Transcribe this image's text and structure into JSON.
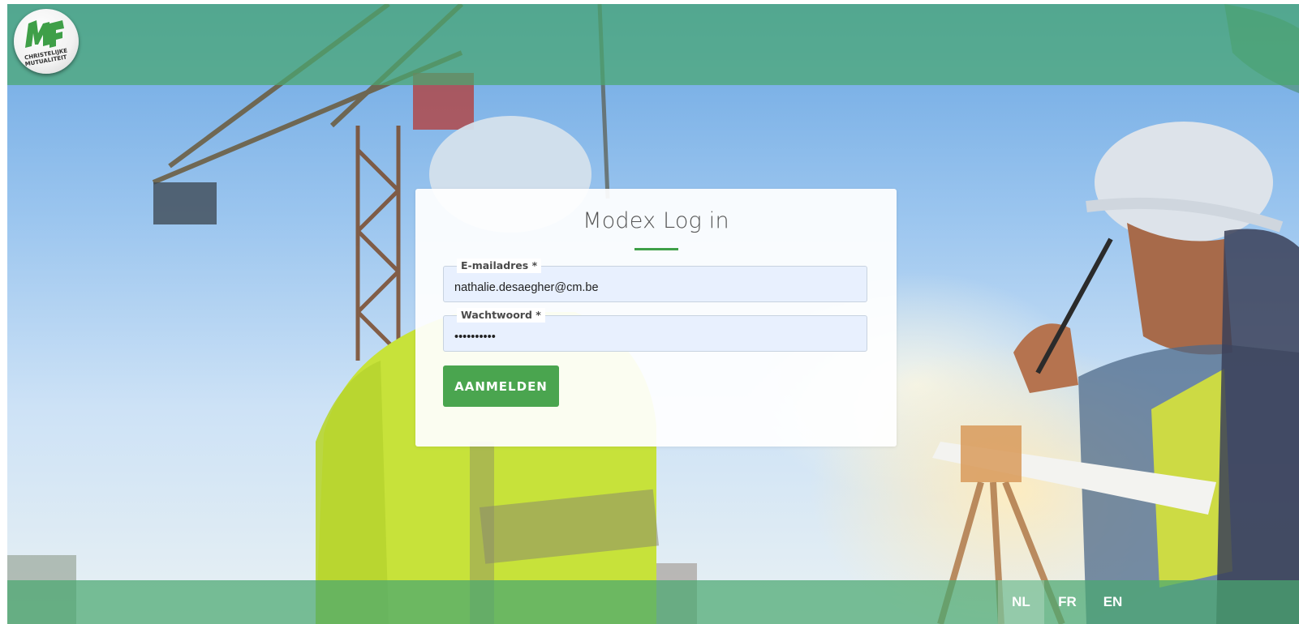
{
  "brand": {
    "logo_text_line1": "CHRISTELIJKE",
    "logo_text_line2": "MUTUALITEIT",
    "accent_color": "#4aa54f",
    "bar_color": "#4aa770"
  },
  "login": {
    "title": "Modex Log in",
    "email_label": "E-mailadres *",
    "email_value": "nathalie.desaegher@cm.be",
    "password_label": "Wachtwoord *",
    "password_value": "••••••••••",
    "submit_label": "AANMELDEN"
  },
  "languages": [
    {
      "label": "NL",
      "active": true
    },
    {
      "label": "FR",
      "active": false
    },
    {
      "label": "EN",
      "active": false
    }
  ]
}
